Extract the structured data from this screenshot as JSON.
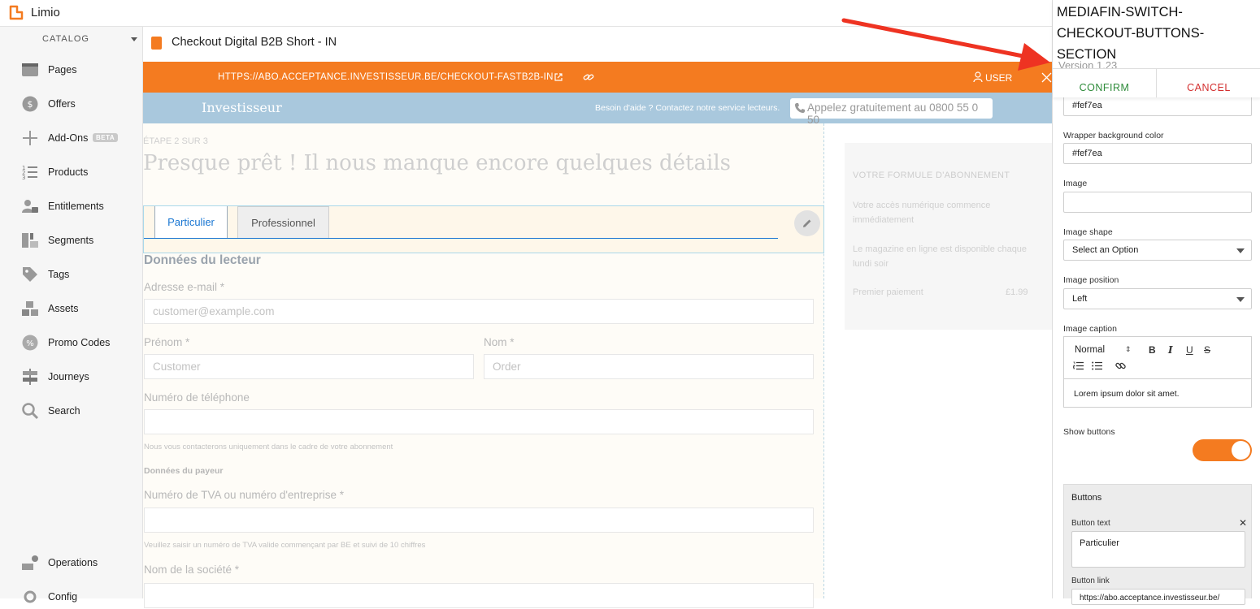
{
  "app": {
    "name": "Limio"
  },
  "sidebar": {
    "section_label": "CATALOG",
    "items": [
      {
        "label": "Pages",
        "icon": "pages-icon"
      },
      {
        "label": "Offers",
        "icon": "offers-icon"
      },
      {
        "label": "Add-Ons",
        "icon": "add-ons-icon",
        "badge": "BETA"
      },
      {
        "label": "Products",
        "icon": "products-icon"
      },
      {
        "label": "Entitlements",
        "icon": "entitlements-icon"
      },
      {
        "label": "Segments",
        "icon": "segments-icon"
      },
      {
        "label": "Tags",
        "icon": "tags-icon"
      },
      {
        "label": "Assets",
        "icon": "assets-icon"
      },
      {
        "label": "Promo Codes",
        "icon": "promo-codes-icon"
      },
      {
        "label": "Journeys",
        "icon": "journeys-icon"
      },
      {
        "label": "Search",
        "icon": "search-icon"
      }
    ],
    "bottom_items": [
      {
        "label": "Operations",
        "icon": "operations-icon"
      },
      {
        "label": "Config",
        "icon": "config-icon"
      }
    ]
  },
  "page": {
    "title": "Checkout Digital B2B Short - IN"
  },
  "urlbar": {
    "url": "HTTPS://ABO.ACCEPTANCE.INVESTISSEUR.BE/CHECKOUT-FASTB2B-IN",
    "user_label": "USER"
  },
  "preview": {
    "banner": {
      "brand": "Investisseur",
      "help_text": "Besoin d'aide ? Contactez notre service lecteurs.",
      "phone": "Appelez gratuitement au 0800 55 0 50"
    },
    "step": "ÉTAPE 2 SUR 3",
    "headline": "Presque prêt ! Il nous manque encore quelques détails",
    "tabs": [
      "Particulier",
      "Professionnel"
    ],
    "reader_heading": "Données du lecteur",
    "fields": {
      "email_label": "Adresse e-mail *",
      "email_placeholder": "customer@example.com",
      "firstname_label": "Prénom *",
      "firstname_placeholder": "Customer",
      "lastname_label": "Nom *",
      "lastname_placeholder": "Order",
      "phone_label": "Numéro de téléphone",
      "phone_hint": "Nous vous contacterons uniquement dans le cadre de votre abonnement",
      "payer_heading": "Données du payeur",
      "vat_label": "Numéro de TVA ou numéro d'entreprise *",
      "vat_hint": "Veuillez saisir un numéro de TVA valide commençant par BE et suivi de 10 chiffres",
      "company_label": "Nom de la société *"
    },
    "summary": {
      "title": "VOTRE FORMULE D'ABONNEMENT",
      "line1": "Votre accès numérique commence immédiatement",
      "line2": "Le magazine en ligne est disponible chaque lundi soir",
      "payment_label": "Premier paiement",
      "payment_value": "£1.99"
    }
  },
  "panel": {
    "component_title": "MEDIAFIN-SWITCH-CHECKOUT-BUTTONS-SECTION",
    "version": "Version 1.23",
    "confirm_label": "CONFIRM",
    "cancel_label": "CANCEL",
    "first_value": "#fef7ea",
    "wrapper_bg_label": "Wrapper background color",
    "wrapper_bg_value": "#fef7ea",
    "image_label": "Image",
    "image_value": "",
    "image_shape_label": "Image shape",
    "image_shape_value": "Select an Option",
    "image_position_label": "Image position",
    "image_position_value": "Left",
    "image_caption_label": "Image caption",
    "caption_format": "Normal",
    "caption_text": "Lorem ipsum dolor sit amet.",
    "show_buttons_label": "Show buttons",
    "show_buttons": true,
    "buttons_title": "Buttons",
    "button_text_label": "Button text",
    "button_text_value": "Particulier",
    "button_link_label": "Button link",
    "button_link_value": "https://abo.acceptance.investisseur.be/"
  },
  "colors": {
    "accent": "#f47b20",
    "confirm": "#2e8b3a",
    "cancel": "#d32f2f",
    "banner": "#a9c8dd",
    "section_bg": "#fef7ea",
    "annotation_arrow": "#ee3322"
  }
}
